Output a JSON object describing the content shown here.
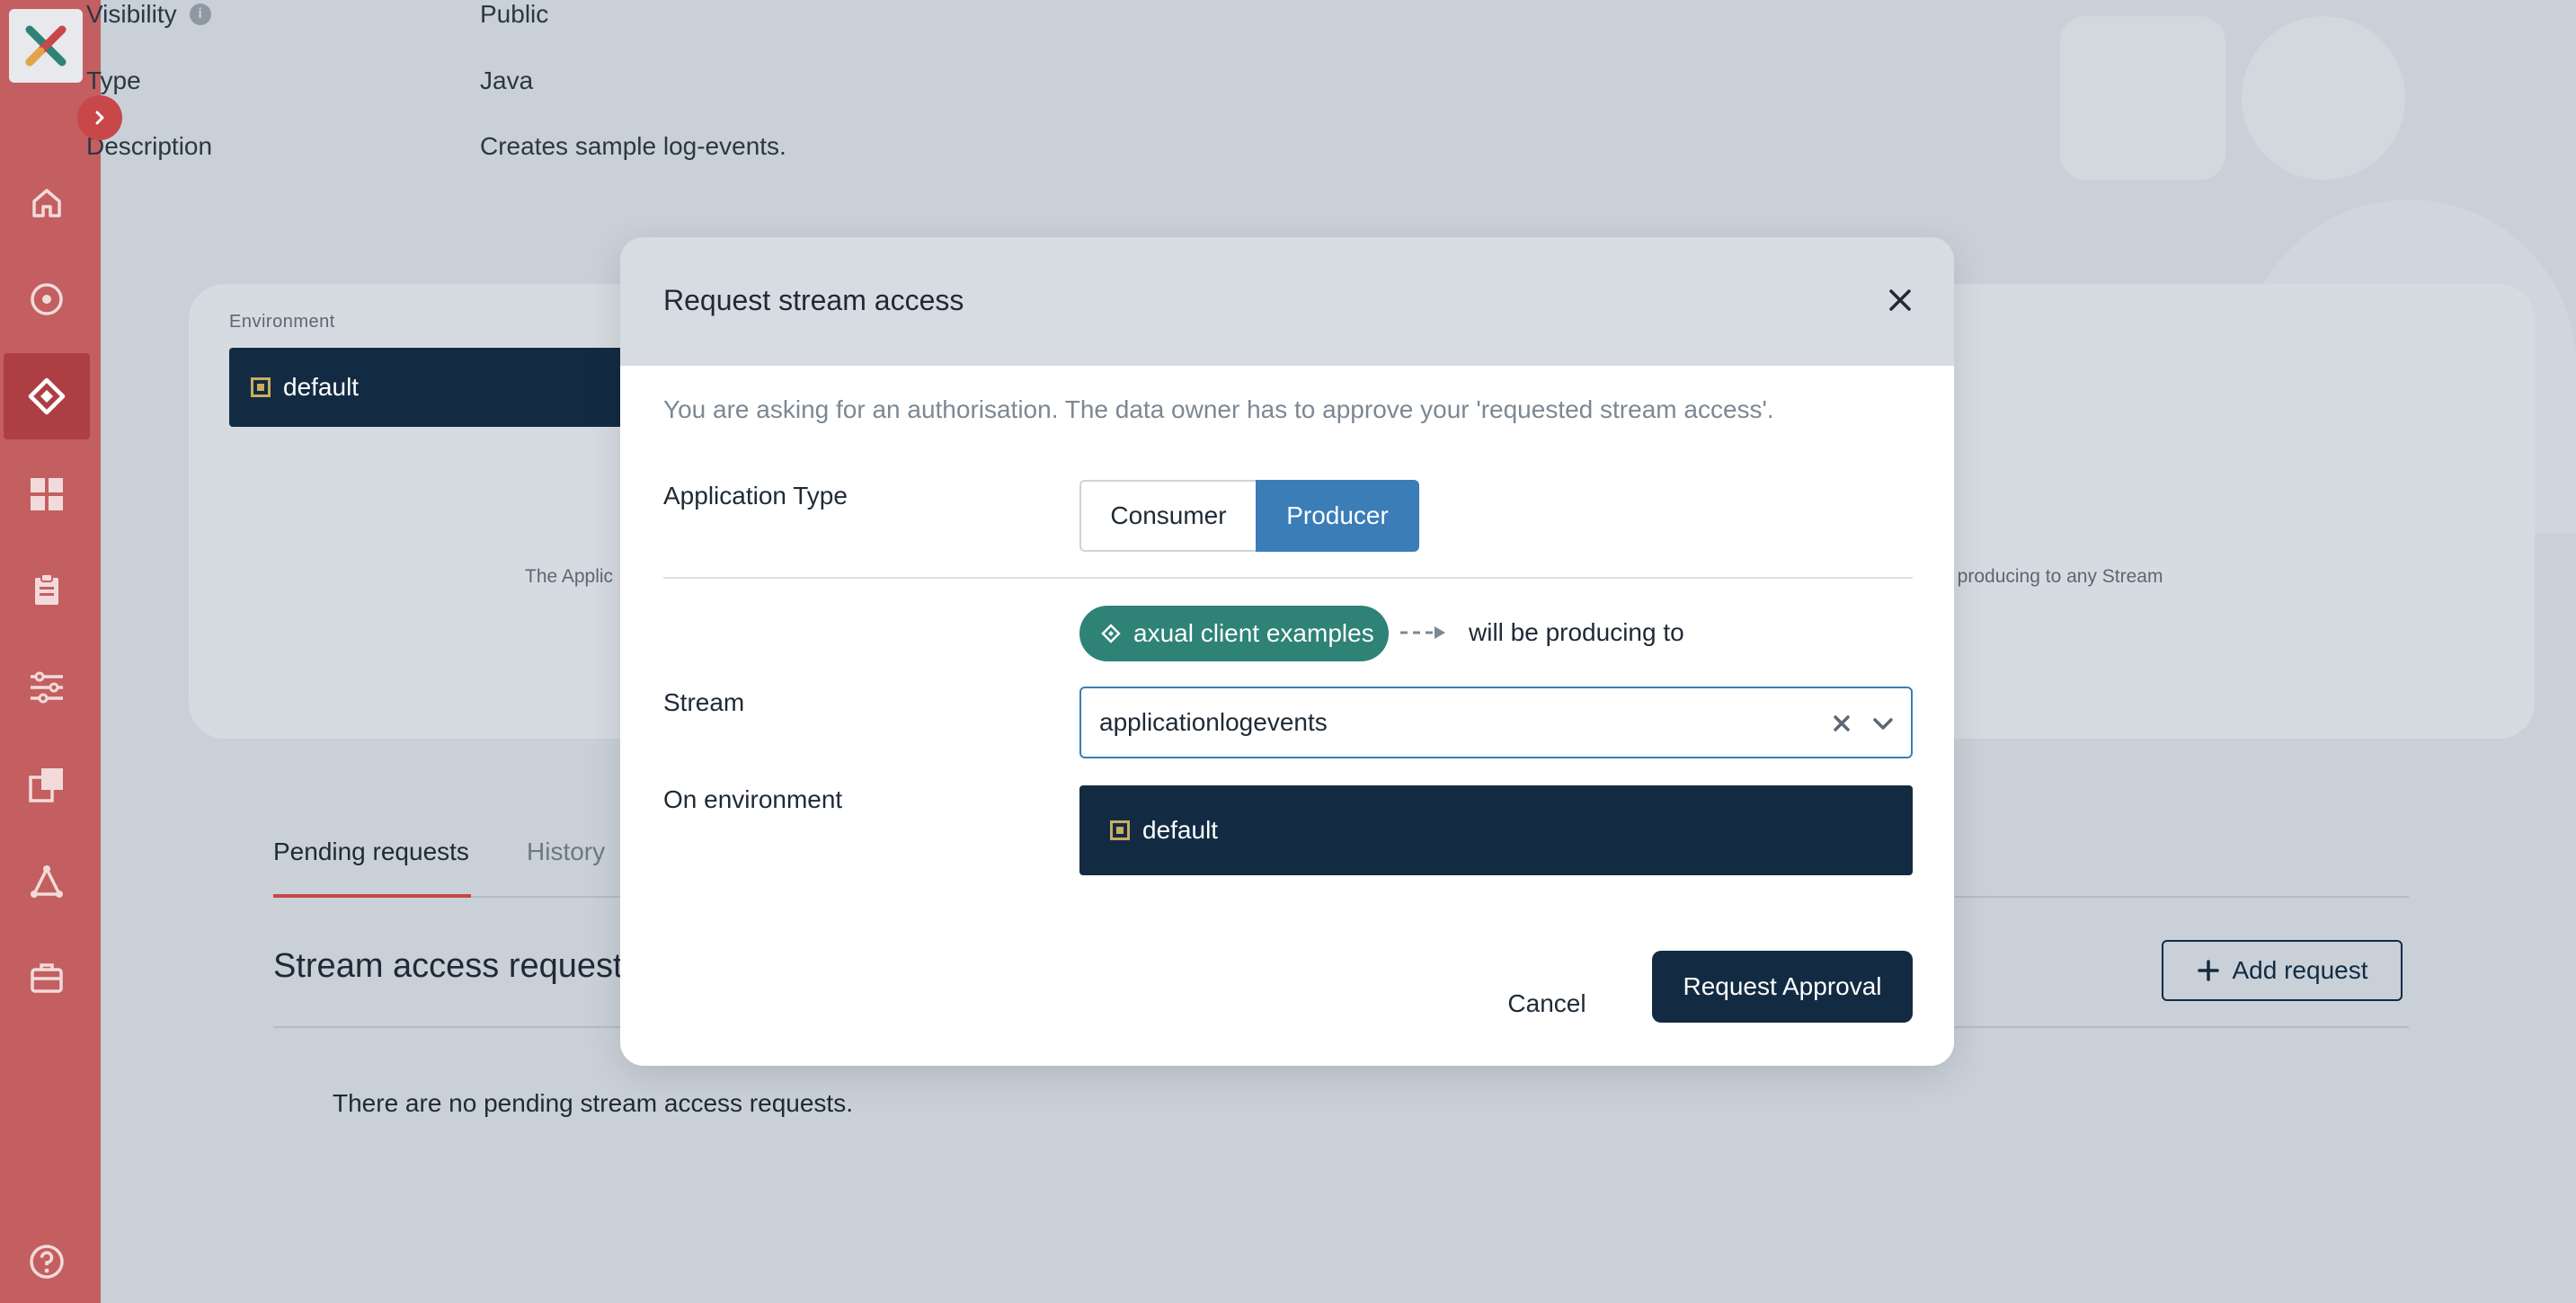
{
  "colors": {
    "sidebar": "#c35f60",
    "sidebar_active": "#ad3f44",
    "primary_dark": "#132b42",
    "accent_blue": "#3b7db7",
    "app_green": "#2e8276",
    "tab_accent": "#c84749",
    "env_gold": "#c9ae5f"
  },
  "sidebar": {
    "logo_icon": "axual-logo",
    "expand_icon": "chevron-right-icon",
    "items": [
      {
        "icon": "home-icon",
        "active": false
      },
      {
        "icon": "target-icon",
        "active": false
      },
      {
        "icon": "diamond-icon",
        "active": true
      },
      {
        "icon": "dashboard-icon",
        "active": false
      },
      {
        "icon": "clipboard-icon",
        "active": false
      },
      {
        "icon": "sliders-icon",
        "active": false
      },
      {
        "icon": "copy-icon",
        "active": false
      },
      {
        "icon": "network-icon",
        "active": false
      },
      {
        "icon": "briefcase-icon",
        "active": false
      }
    ],
    "help_icon": "help-icon"
  },
  "details": {
    "visibility_label": "Visibility",
    "visibility_value": "Public",
    "type_label": "Type",
    "type_value": "Java",
    "description_label": "Description",
    "description_value": "Creates sample log-events."
  },
  "environment_card": {
    "label": "Environment",
    "selected": "default",
    "text_left": "The Applic",
    "text_right": "t producing to any Stream"
  },
  "tabs": [
    {
      "label": "Pending requests",
      "active": true
    },
    {
      "label": "History",
      "active": false
    }
  ],
  "requests_section": {
    "title": "Stream access requests",
    "add_button": "Add request",
    "empty_message": "There are no pending stream access requests."
  },
  "modal": {
    "title": "Request stream access",
    "description": "You are asking for an authorisation. The data owner has to approve your 'requested stream access'.",
    "application_type_label": "Application Type",
    "application_type_options": [
      "Consumer",
      "Producer"
    ],
    "application_type_selected": "Producer",
    "application_chip": "axual client examples",
    "relation_text": "will be producing to",
    "stream_label": "Stream",
    "stream_value": "applicationlogevents",
    "environment_label": "On environment",
    "environment_value": "default",
    "cancel_label": "Cancel",
    "submit_label": "Request Approval"
  }
}
